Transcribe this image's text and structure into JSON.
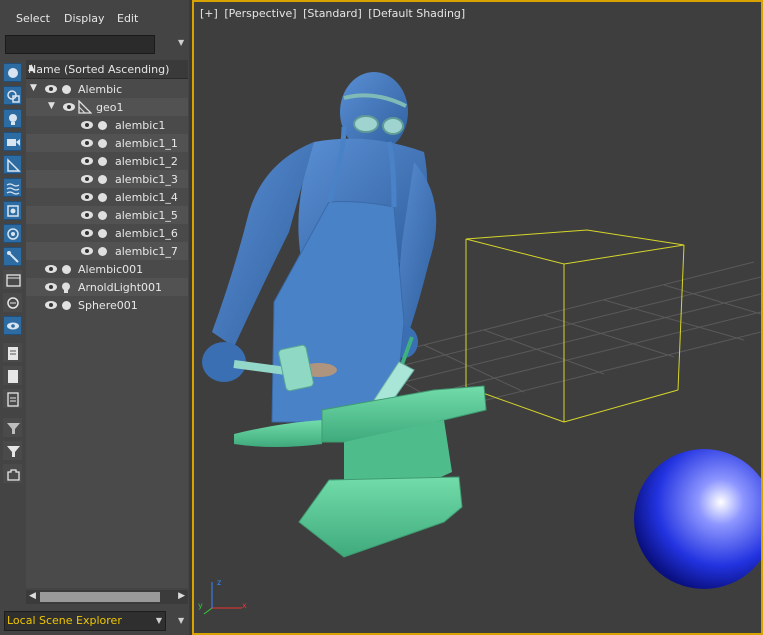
{
  "menu": {
    "select": "Select",
    "display": "Display",
    "edit": "Edit"
  },
  "search": {
    "value": ""
  },
  "column_header": "Name (Sorted Ascending)",
  "tree": {
    "alembic": "Alembic",
    "geo1": "geo1",
    "children": [
      "alembic1",
      "alembic1_1",
      "alembic1_2",
      "alembic1_3",
      "alembic1_4",
      "alembic1_5",
      "alembic1_6",
      "alembic1_7"
    ],
    "alembic001": "Alembic001",
    "arnoldlight001": "ArnoldLight001",
    "sphere001": "Sphere001"
  },
  "footer": {
    "explorer_name": "Local Scene Explorer"
  },
  "viewport": {
    "plus": "[+]",
    "view": "[Perspective]",
    "mode": "[Standard]",
    "shading": "[Default Shading]"
  },
  "axes": {
    "x": "x",
    "y": "y",
    "z": "z"
  },
  "colors": {
    "accent_active": "#d8a200",
    "footer_text": "#f0c800",
    "character": "#3f74b8",
    "anvil": "#5fcf9c",
    "sphere": "#2a3df0",
    "bbox": "#d6d62a"
  }
}
